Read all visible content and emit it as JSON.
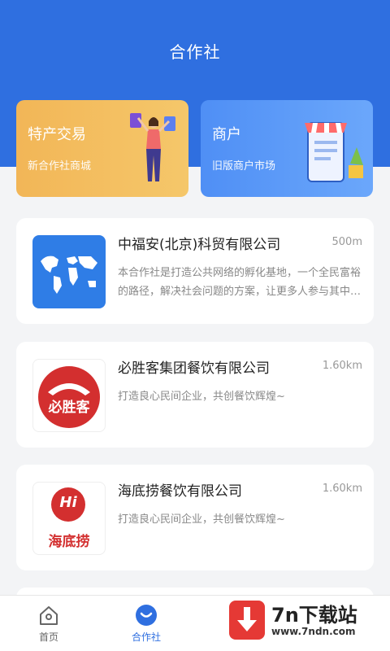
{
  "header": {
    "title": "合作社"
  },
  "promos": [
    {
      "title": "特产交易",
      "subtitle": "新合作社商城"
    },
    {
      "title": "商户",
      "subtitle": "旧版商户市场"
    }
  ],
  "companies": [
    {
      "name": "中福安(北京)科贸有限公司",
      "distance": "500m",
      "description": "本合作社是打造公共网络的孵化基地，一个全民富裕的路径，解决社会问题的方案，让更多人参与其中共同发展"
    },
    {
      "name": "必胜客集团餐饮有限公司",
      "distance": "1.60km",
      "description": "打造良心民间企业，共创餐饮辉煌~",
      "logo_text": "必胜客"
    },
    {
      "name": "海底捞餐饮有限公司",
      "distance": "1.60km",
      "description": "打造良心民间企业，共创餐饮辉煌~",
      "logo_text": "海底捞",
      "logo_mark": "Hi"
    }
  ],
  "tabbar": {
    "items": [
      {
        "label": "首页",
        "icon": "home-icon",
        "active": false
      },
      {
        "label": "合作社",
        "icon": "cooperative-icon",
        "active": true
      }
    ],
    "active_color": "#2f6fe0",
    "inactive_color": "#666666"
  },
  "watermark": {
    "title": "7n下载站",
    "url": "www.7ndn.com"
  },
  "colors": {
    "primary": "#2f6fe0",
    "promo_orange": "#f2b657",
    "promo_blue": "#5b9af7",
    "brand_red": "#d32f2f"
  }
}
